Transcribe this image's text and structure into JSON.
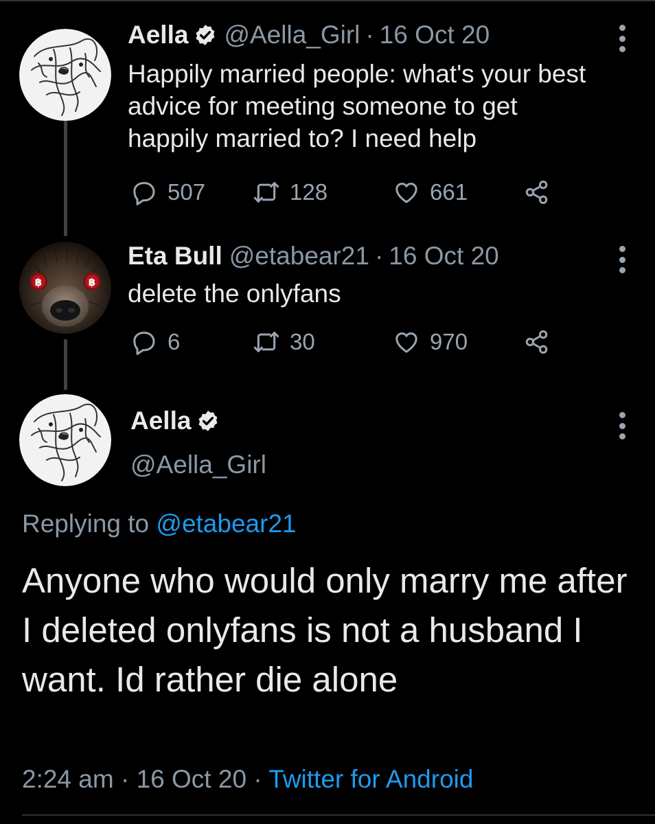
{
  "tweets": [
    {
      "name": "Aella",
      "handle": "@Aella_Girl",
      "separator": "·",
      "date": "16 Oct 20",
      "text_lines": [
        "Happily married people: what's your best",
        "advice for meeting someone to get",
        "happily married to? I need help"
      ],
      "replies": "507",
      "retweets": "128",
      "likes": "661"
    },
    {
      "name": "Eta Bull",
      "handle": "@etabear21",
      "separator": "·",
      "date": "16 Oct 20",
      "text_lines": [
        "delete the onlyfans"
      ],
      "replies": "6",
      "retweets": "30",
      "likes": "970"
    }
  ],
  "main": {
    "name": "Aella",
    "handle": "@Aella_Girl",
    "replying_prefix": "Replying to",
    "replying_mention": "@etabear21",
    "text": "Anyone who would only marry me after I deleted onlyfans is not a husband I want. Id rather die alone",
    "time": "2:24 am",
    "separator1": "·",
    "date": "16 Oct 20",
    "separator2": "·",
    "client": "Twitter for Android"
  },
  "icons": {
    "verified": "verified-badge-icon",
    "reply": "reply-icon",
    "retweet": "retweet-icon",
    "like": "heart-icon",
    "share": "share-icon",
    "more": "more-vertical-icon"
  },
  "colors": {
    "background": "#000000",
    "text": "#e7e9ea",
    "muted": "#8b98a5",
    "link": "#1d9bf0"
  }
}
